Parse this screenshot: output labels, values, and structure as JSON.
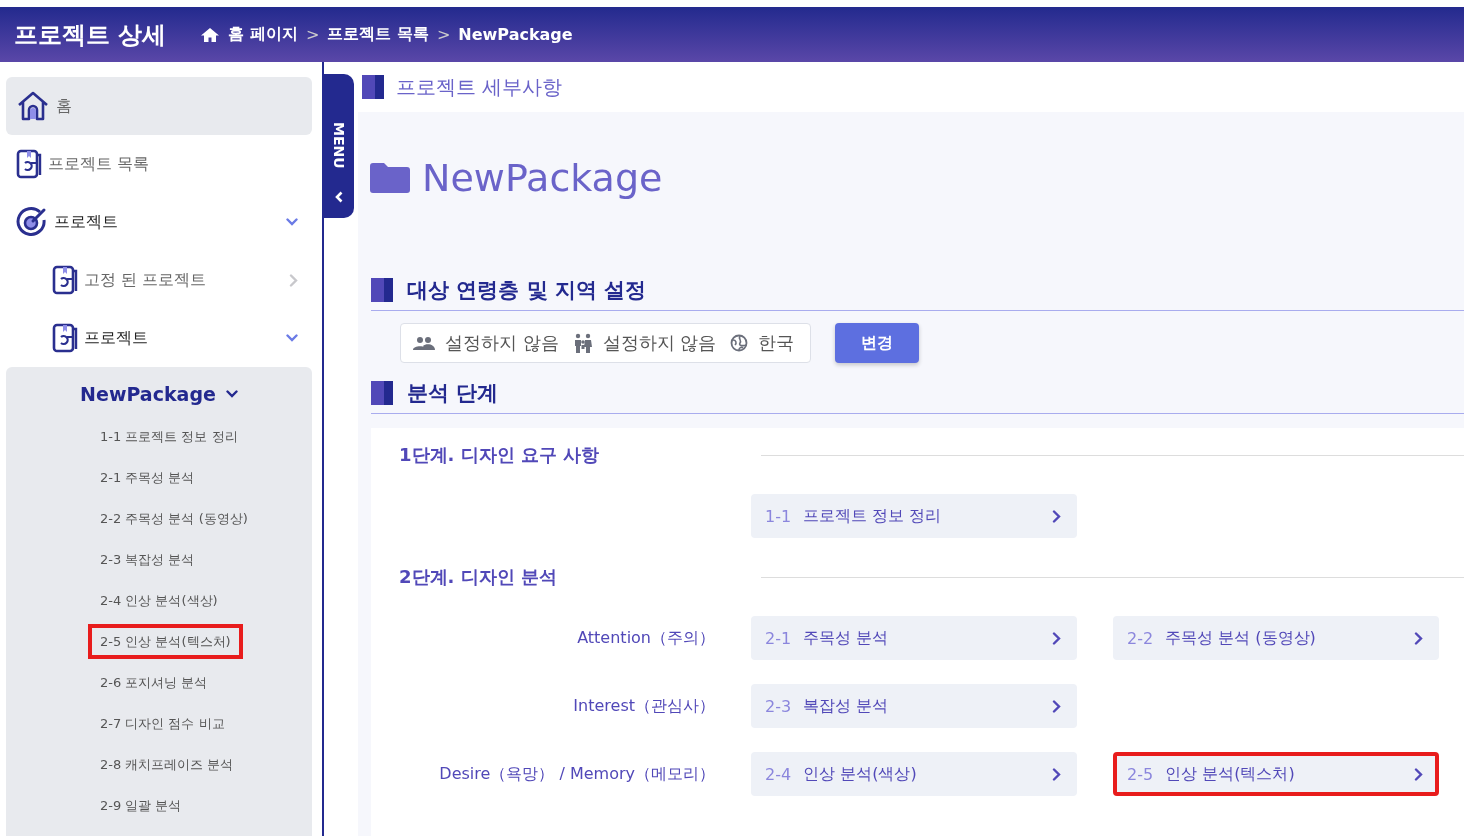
{
  "header": {
    "title": "프로젝트 상세",
    "separator": ">",
    "breadcrumb": [
      {
        "label": "홈 페이지"
      },
      {
        "label": "프로젝트 목록"
      },
      {
        "label": "NewPackage"
      }
    ]
  },
  "sidebar": {
    "items": [
      {
        "label": "홈",
        "kind": "home",
        "selected": true
      },
      {
        "label": "프로젝트 목록",
        "kind": "book",
        "selected": false
      },
      {
        "label": "프로젝트",
        "kind": "target",
        "selected": false,
        "expanded": true,
        "children": [
          {
            "label": "고정 된 프로젝트",
            "kind": "book",
            "selected": false,
            "expanded": false
          },
          {
            "label": "프로젝트",
            "kind": "book",
            "selected": false,
            "expanded": true,
            "children": [
              {
                "label": "NewPackage",
                "expanded": true,
                "children": [
                  {
                    "label": "1-1 프로젝트 정보 정리",
                    "highlighted": false
                  },
                  {
                    "label": "2-1 주목성 분석",
                    "highlighted": false
                  },
                  {
                    "label": "2-2 주목성 분석 (동영상)",
                    "highlighted": false
                  },
                  {
                    "label": "2-3 복잡성 분석",
                    "highlighted": false
                  },
                  {
                    "label": "2-4 인상 분석(색상)",
                    "highlighted": false
                  },
                  {
                    "label": "2-5 인상 분석(텍스처)",
                    "highlighted": true
                  },
                  {
                    "label": "2-6 포지셔닝 분석",
                    "highlighted": false
                  },
                  {
                    "label": "2-7 디자인 점수 비교",
                    "highlighted": false
                  },
                  {
                    "label": "2-8 캐치프레이즈 분석",
                    "highlighted": false
                  },
                  {
                    "label": "2-9 일괄 분석",
                    "highlighted": false
                  }
                ]
              }
            ]
          }
        ]
      }
    ]
  },
  "menu_tab": {
    "label": "MENU"
  },
  "section_title": "프로젝트 세부사항",
  "package": {
    "name": "NewPackage"
  },
  "target_section": {
    "title": "대상 연령층 및 지역 설정",
    "settings": [
      {
        "kind": "people",
        "value": "설정하지 않음"
      },
      {
        "kind": "family",
        "value": "설정하지 않음"
      },
      {
        "kind": "globe",
        "value": "한국"
      }
    ],
    "button": "변경"
  },
  "analysis": {
    "title": "분석 단계",
    "stages": [
      {
        "title": "1단계. 디자인 요구 사항",
        "rows": [
          {
            "steps": [
              {
                "code": "1-1",
                "name": "프로젝트 정보 정리",
                "highlighted": false
              }
            ]
          }
        ]
      },
      {
        "title": "2단계. 디자인 분석",
        "rows": [
          {
            "label": "Attention（주의）",
            "steps": [
              {
                "code": "2-1",
                "name": "주목성 분석",
                "highlighted": false
              },
              {
                "code": "2-2",
                "name": "주목성 분석 (동영상)",
                "highlighted": false
              }
            ]
          },
          {
            "label": "Interest（관심사）",
            "steps": [
              {
                "code": "2-3",
                "name": "복잡성 분석",
                "highlighted": false
              }
            ]
          },
          {
            "label": "Desire（욕망） / Memory（메모리）",
            "steps": [
              {
                "code": "2-4",
                "name": "인상 분석(색상)",
                "highlighted": false
              },
              {
                "code": "2-5",
                "name": "인상 분석(텍스처)",
                "highlighted": true
              }
            ]
          }
        ]
      }
    ]
  }
}
